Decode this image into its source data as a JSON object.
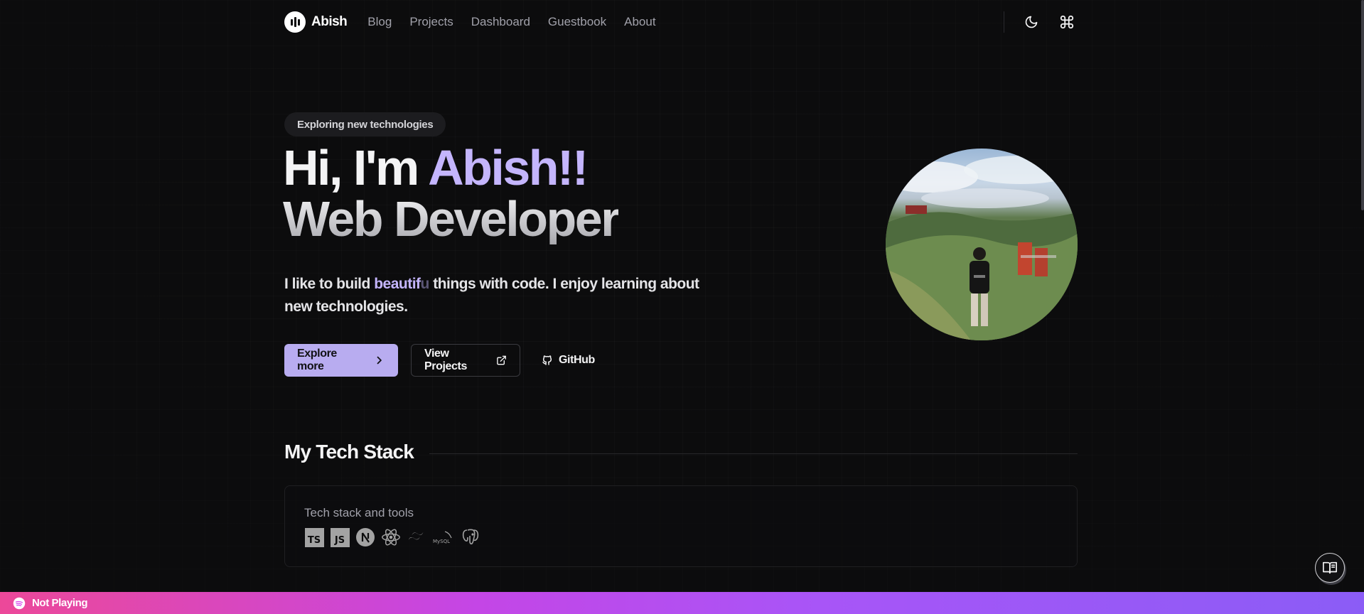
{
  "nav": {
    "logo_text": "Abish",
    "links": [
      "Blog",
      "Projects",
      "Dashboard",
      "Guestbook",
      "About"
    ],
    "theme_icon": "moon-icon",
    "command_icon": "command-icon"
  },
  "hero": {
    "badge": "Exploring new technologies",
    "greeting": "Hi, I'm ",
    "name": "Abish!!",
    "role": "Web Developer",
    "desc_before": "I like to build ",
    "desc_accent": "beautif",
    "desc_fade": "u",
    "desc_after": " things with code. I enjoy learning about new technologies.",
    "buttons": {
      "explore": "Explore more",
      "projects": "View Projects",
      "github": "GitHub"
    }
  },
  "tech_stack": {
    "title": "My Tech Stack",
    "card_label": "Tech stack and tools",
    "icons": [
      "typescript-icon",
      "javascript-icon",
      "nextjs-icon",
      "react-icon",
      "tailwind-icon",
      "mysql-icon",
      "postgresql-icon"
    ],
    "ts": "TS",
    "js": "JS",
    "mysql": "MySQL"
  },
  "player": {
    "status": "Not Playing",
    "icon": "spotify-icon"
  },
  "colors": {
    "accent": "#c4b5fd",
    "primary_button": "#b8acf0",
    "background": "#0c0c0d",
    "bar_start": "#ec4899",
    "bar_end": "#8b5cf6"
  }
}
